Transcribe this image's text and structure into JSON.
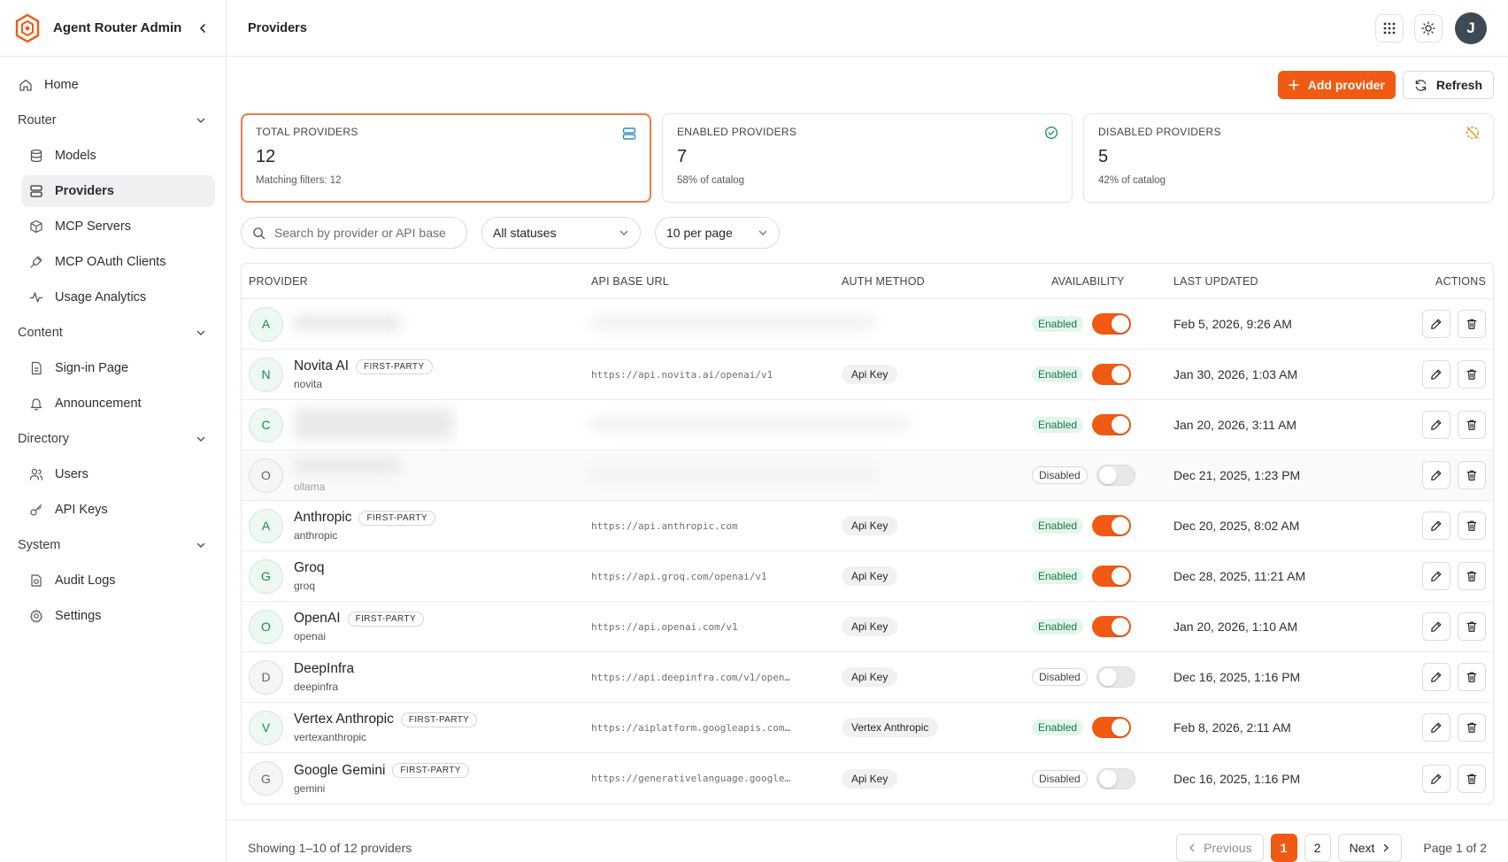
{
  "app": {
    "title": "Agent Router Admin",
    "accent_color": "#f05a12"
  },
  "sidebar": {
    "home": "Home",
    "groups": [
      {
        "label": "Router",
        "items": [
          {
            "label": "Models",
            "icon": "database-icon"
          },
          {
            "label": "Providers",
            "icon": "server-icon",
            "active": true
          },
          {
            "label": "MCP Servers",
            "icon": "box-icon"
          },
          {
            "label": "MCP OAuth Clients",
            "icon": "plug-icon"
          },
          {
            "label": "Usage Analytics",
            "icon": "activity-icon"
          }
        ]
      },
      {
        "label": "Content",
        "items": [
          {
            "label": "Sign-in Page",
            "icon": "document-icon"
          },
          {
            "label": "Announcement",
            "icon": "bell-icon"
          }
        ]
      },
      {
        "label": "Directory",
        "items": [
          {
            "label": "Users",
            "icon": "users-icon"
          },
          {
            "label": "API Keys",
            "icon": "key-icon"
          }
        ]
      },
      {
        "label": "System",
        "items": [
          {
            "label": "Audit Logs",
            "icon": "audit-icon"
          },
          {
            "label": "Settings",
            "icon": "gear-icon"
          }
        ]
      }
    ]
  },
  "header": {
    "title": "Providers",
    "avatar_initial": "J"
  },
  "toolbar": {
    "add_label": "Add provider",
    "refresh_label": "Refresh"
  },
  "stats": {
    "total": {
      "label": "TOTAL PROVIDERS",
      "value": "12",
      "sub": "Matching filters: 12"
    },
    "enabled": {
      "label": "ENABLED PROVIDERS",
      "value": "7",
      "sub": "58% of catalog"
    },
    "disabled": {
      "label": "DISABLED PROVIDERS",
      "value": "5",
      "sub": "42% of catalog"
    }
  },
  "filters": {
    "search_placeholder": "Search by provider or API base",
    "status_value": "All statuses",
    "per_page_value": "10 per page"
  },
  "table": {
    "headers": {
      "provider": "PROVIDER",
      "url": "API BASE URL",
      "auth": "AUTH METHOD",
      "availability": "AVAILABILITY",
      "updated": "LAST UPDATED",
      "actions": "ACTIONS"
    },
    "rows": [
      {
        "letter": "A",
        "name": "",
        "badge": "",
        "slug": "",
        "url": "",
        "auth": "",
        "status": "Enabled",
        "enabled": true,
        "updated": "Feb 5, 2026, 9:26 AM",
        "redacted": true
      },
      {
        "letter": "N",
        "name": "Novita AI",
        "badge": "FIRST-PARTY",
        "slug": "novita",
        "url": "https://api.novita.ai/openai/v1",
        "auth": "Api Key",
        "status": "Enabled",
        "enabled": true,
        "updated": "Jan 30, 2026, 1:03 AM",
        "redacted": false
      },
      {
        "letter": "C",
        "name": "",
        "badge": "",
        "slug": "",
        "url": "",
        "auth": "",
        "status": "Enabled",
        "enabled": true,
        "updated": "Jan 20, 2026, 3:11 AM",
        "redacted": true
      },
      {
        "letter": "O",
        "name": "",
        "badge": "",
        "slug": "ollama",
        "url": "",
        "auth": "",
        "status": "Disabled",
        "enabled": false,
        "updated": "Dec 21, 2025, 1:23 PM",
        "redacted": true
      },
      {
        "letter": "A",
        "name": "Anthropic",
        "badge": "FIRST-PARTY",
        "slug": "anthropic",
        "url": "https://api.anthropic.com",
        "auth": "Api Key",
        "status": "Enabled",
        "enabled": true,
        "updated": "Dec 20, 2025, 8:02 AM",
        "redacted": false
      },
      {
        "letter": "G",
        "name": "Groq",
        "badge": "",
        "slug": "groq",
        "url": "https://api.groq.com/openai/v1",
        "auth": "Api Key",
        "status": "Enabled",
        "enabled": true,
        "updated": "Dec 28, 2025, 11:21 AM",
        "redacted": false
      },
      {
        "letter": "O",
        "name": "OpenAI",
        "badge": "FIRST-PARTY",
        "slug": "openai",
        "url": "https://api.openai.com/v1",
        "auth": "Api Key",
        "status": "Enabled",
        "enabled": true,
        "updated": "Jan 20, 2026, 1:10 AM",
        "redacted": false
      },
      {
        "letter": "D",
        "name": "DeepInfra",
        "badge": "",
        "slug": "deepinfra",
        "url": "https://api.deepinfra.com/v1/open…",
        "auth": "Api Key",
        "status": "Disabled",
        "enabled": false,
        "updated": "Dec 16, 2025, 1:16 PM",
        "redacted": false
      },
      {
        "letter": "V",
        "name": "Vertex Anthropic",
        "badge": "FIRST-PARTY",
        "slug": "vertexanthropic",
        "url": "https://aiplatform.googleapis.com…",
        "auth": "Vertex Anthropic",
        "status": "Enabled",
        "enabled": true,
        "updated": "Feb 8, 2026, 2:11 AM",
        "redacted": false
      },
      {
        "letter": "G",
        "name": "Google Gemini",
        "badge": "FIRST-PARTY",
        "slug": "gemini",
        "url": "https://generativelanguage.google…",
        "auth": "Api Key",
        "status": "Disabled",
        "enabled": false,
        "updated": "Dec 16, 2025, 1:16 PM",
        "redacted": false
      }
    ]
  },
  "footer": {
    "showing": "Showing 1–10 of 12 providers",
    "previous": "Previous",
    "pages": [
      "1",
      "2"
    ],
    "current_page": "1",
    "next": "Next",
    "page_label": "Page 1 of 2"
  }
}
